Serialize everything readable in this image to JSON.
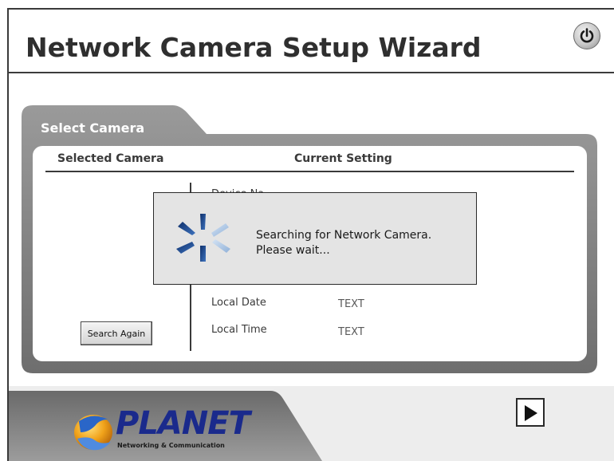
{
  "header": {
    "title": "Network Camera Setup Wizard",
    "power_icon": "power-icon"
  },
  "panel": {
    "label": "Select Camera",
    "col_selected": "Selected Camera",
    "col_current": "Current Setting",
    "partial_field_label": "Device Na",
    "fields": [
      {
        "label": "Local Date",
        "value": "TEXT"
      },
      {
        "label": "Local Time",
        "value": "TEXT"
      }
    ],
    "search_again_label": "Search Again"
  },
  "modal": {
    "line1": "Searching for Network Camera.",
    "line2": "Please wait...",
    "icon": "spinner-icon"
  },
  "footer": {
    "next_icon": "play-arrow-icon",
    "logo_word": "PLANET",
    "logo_tagline": "Networking & Communication"
  },
  "colors": {
    "panel_gray": "#777777",
    "title_text": "#2f2f2f",
    "logo_blue": "#1a2a8c",
    "modal_bg": "#e4e4e4"
  }
}
